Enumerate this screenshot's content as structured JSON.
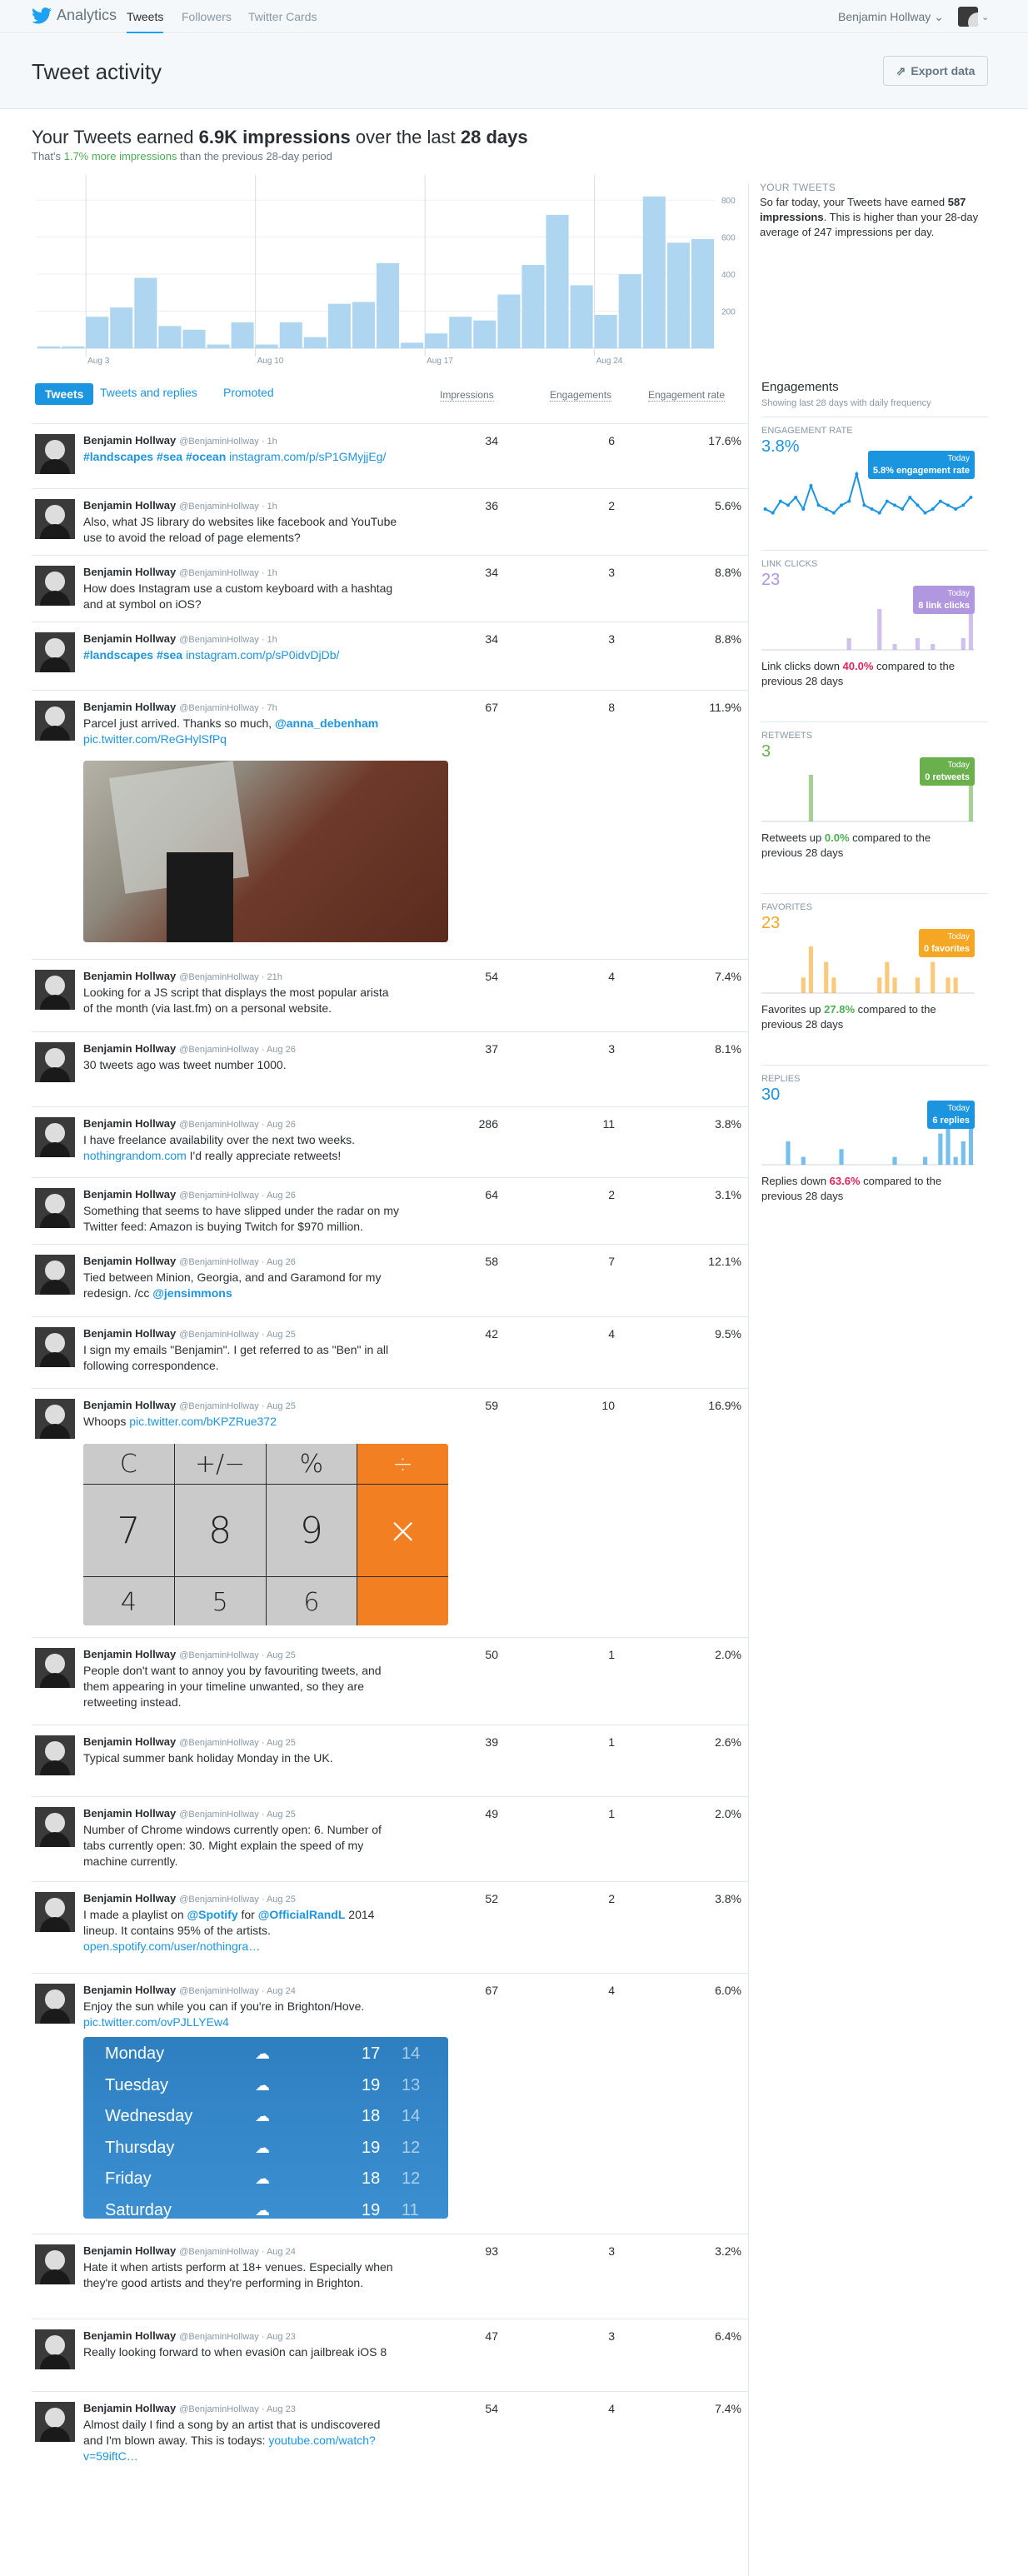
{
  "nav": {
    "brand": "Analytics",
    "tabs": [
      "Tweets",
      "Followers",
      "Twitter Cards"
    ],
    "user": "Benjamin Hollway"
  },
  "header": {
    "title": "Tweet activity",
    "export": "Export data"
  },
  "summary": {
    "prefix": "Your Tweets earned ",
    "impressions": "6.9K impressions",
    "middle": " over the last ",
    "period": "28 days",
    "sub_prefix": "That's ",
    "sub_highlight": "1.7% more impressions",
    "sub_suffix": " than the previous 28-day period"
  },
  "chart_data": {
    "type": "bar",
    "title": "",
    "x_labels": [
      "Aug 3",
      "Aug 10",
      "Aug 17",
      "Aug 24"
    ],
    "ylim": [
      0,
      900
    ],
    "y_ticks": [
      200,
      400,
      600,
      800
    ],
    "values": [
      10,
      10,
      170,
      220,
      380,
      120,
      100,
      20,
      140,
      20,
      140,
      60,
      240,
      250,
      460,
      30,
      80,
      170,
      150,
      290,
      450,
      720,
      340,
      180,
      400,
      820,
      570,
      590
    ],
    "color": "#aed6f1"
  },
  "your_tweets": {
    "label": "YOUR TWEETS",
    "text_prefix": "So far today, your Tweets have earned ",
    "bold": "587 impressions",
    "text_suffix": ". This is higher than your 28-day average of 247 impressions per day."
  },
  "tabs": {
    "items": [
      "Tweets",
      "Tweets and replies",
      "Promoted"
    ],
    "cols": [
      "Impressions",
      "Engagements",
      "Engagement rate"
    ]
  },
  "tweets": [
    {
      "name": "Benjamin Hollway",
      "handle": "@BenjaminHollway · 1h",
      "text": "#landscapes #sea #ocean instagram.com/p/sP1GMyjjEg/",
      "imp": "34",
      "eng": "6",
      "rate": "17.6%"
    },
    {
      "name": "Benjamin Hollway",
      "handle": "@BenjaminHollway · 1h",
      "text": "Also, what JS library do websites like facebook and YouTube use to avoid the reload of page elements?",
      "imp": "36",
      "eng": "2",
      "rate": "5.6%"
    },
    {
      "name": "Benjamin Hollway",
      "handle": "@BenjaminHollway · 1h",
      "text": "How does Instagram use a custom keyboard with a hashtag and at symbol on iOS?",
      "imp": "34",
      "eng": "3",
      "rate": "8.8%"
    },
    {
      "name": "Benjamin Hollway",
      "handle": "@BenjaminHollway · 1h",
      "text": "#landscapes #sea instagram.com/p/sP0idvDjDb/",
      "imp": "34",
      "eng": "3",
      "rate": "8.8%"
    },
    {
      "name": "Benjamin Hollway",
      "handle": "@BenjaminHollway · 7h",
      "text": "Parcel just arrived. Thanks so much, @anna_debenham pic.twitter.com/ReGHylSfPq",
      "imp": "67",
      "eng": "8",
      "rate": "11.9%"
    },
    {
      "name": "Benjamin Hollway",
      "handle": "@BenjaminHollway · 21h",
      "text": "Looking for a JS script that displays the most popular arista of the month (via last.fm) on a personal website.",
      "imp": "54",
      "eng": "4",
      "rate": "7.4%"
    },
    {
      "name": "Benjamin Hollway",
      "handle": "@BenjaminHollway · Aug 26",
      "text": "30 tweets ago was tweet number 1000.",
      "imp": "37",
      "eng": "3",
      "rate": "8.1%"
    },
    {
      "name": "Benjamin Hollway",
      "handle": "@BenjaminHollway · Aug 26",
      "text": "I have freelance availability over the next two weeks. nothingrandom.com I'd really appreciate retweets!",
      "imp": "286",
      "eng": "11",
      "rate": "3.8%"
    },
    {
      "name": "Benjamin Hollway",
      "handle": "@BenjaminHollway · Aug 26",
      "text": "Something that seems to have slipped under the radar on my Twitter feed: Amazon is buying Twitch for $970 million.",
      "imp": "64",
      "eng": "2",
      "rate": "3.1%"
    },
    {
      "name": "Benjamin Hollway",
      "handle": "@BenjaminHollway · Aug 26",
      "text": "Tied between Minion, Georgia, and and Garamond for my redesign. /cc @jensimmons",
      "imp": "58",
      "eng": "7",
      "rate": "12.1%"
    },
    {
      "name": "Benjamin Hollway",
      "handle": "@BenjaminHollway · Aug 25",
      "text": "I sign my emails \"Benjamin\". I get referred to as \"Ben\" in all following correspondence.",
      "imp": "42",
      "eng": "4",
      "rate": "9.5%"
    },
    {
      "name": "Benjamin Hollway",
      "handle": "@BenjaminHollway · Aug 25",
      "text": "Whoops pic.twitter.com/bKPZRue372",
      "imp": "59",
      "eng": "10",
      "rate": "16.9%"
    },
    {
      "name": "Benjamin Hollway",
      "handle": "@BenjaminHollway · Aug 25",
      "text": "People don't want to annoy you by favouriting tweets, and them appearing in your timeline unwanted, so they are retweeting instead.",
      "imp": "50",
      "eng": "1",
      "rate": "2.0%"
    },
    {
      "name": "Benjamin Hollway",
      "handle": "@BenjaminHollway · Aug 25",
      "text": "Typical summer bank holiday Monday in the UK.",
      "imp": "39",
      "eng": "1",
      "rate": "2.6%"
    },
    {
      "name": "Benjamin Hollway",
      "handle": "@BenjaminHollway · Aug 25",
      "text": "Number of Chrome windows currently open: 6. Number of tabs currently open: 30. Might explain the speed of my machine currently.",
      "imp": "49",
      "eng": "1",
      "rate": "2.0%"
    },
    {
      "name": "Benjamin Hollway",
      "handle": "@BenjaminHollway · Aug 25",
      "text": "I made a playlist on @Spotify for @OfficialRandL 2014 lineup. It contains 95% of the artists. open.spotify.com/user/nothingra…",
      "imp": "52",
      "eng": "2",
      "rate": "3.8%"
    },
    {
      "name": "Benjamin Hollway",
      "handle": "@BenjaminHollway · Aug 24",
      "text": "Enjoy the sun while you can if you're in Brighton/Hove. pic.twitter.com/ovPJLLYEw4",
      "imp": "67",
      "eng": "4",
      "rate": "6.0%"
    },
    {
      "name": "Benjamin Hollway",
      "handle": "@BenjaminHollway · Aug 24",
      "text": "Hate it when artists perform at 18+ venues. Especially when they're good artists and they're performing in Brighton.",
      "imp": "93",
      "eng": "3",
      "rate": "3.2%"
    },
    {
      "name": "Benjamin Hollway",
      "handle": "@BenjaminHollway · Aug 23",
      "text": "Really looking forward to when evasi0n can jailbreak iOS 8",
      "imp": "47",
      "eng": "3",
      "rate": "6.4%"
    },
    {
      "name": "Benjamin Hollway",
      "handle": "@BenjaminHollway · Aug 23",
      "text": "Almost daily I find a song by an artist that is undiscovered and I'm blown away. This is todays: youtube.com/watch?v=59iftC…",
      "imp": "54",
      "eng": "4",
      "rate": "7.4%"
    }
  ],
  "calculator": {
    "top": [
      "C",
      "+/−",
      "%",
      "÷"
    ],
    "middle": [
      "7",
      "8",
      "9",
      "×"
    ],
    "bottom": [
      "4",
      "5",
      "6"
    ]
  },
  "weather": [
    {
      "day": "Monday",
      "hi": "17",
      "lo": "14"
    },
    {
      "day": "Tuesday",
      "hi": "19",
      "lo": "13"
    },
    {
      "day": "Wednesday",
      "hi": "18",
      "lo": "14"
    },
    {
      "day": "Thursday",
      "hi": "19",
      "lo": "12"
    },
    {
      "day": "Friday",
      "hi": "18",
      "lo": "12"
    },
    {
      "day": "Saturday",
      "hi": "19",
      "lo": "11"
    }
  ],
  "engagements": {
    "title": "Engagements",
    "subtitle": "Showing last 28 days with daily frequency",
    "rate": {
      "label": "ENGAGEMENT RATE",
      "value": "3.8%",
      "today": "Today",
      "callout": "5.8% engagement rate",
      "color": "#1b95e0",
      "values": [
        3,
        2,
        5,
        4,
        6,
        3,
        9,
        4,
        3,
        2,
        4,
        5,
        12,
        4,
        3,
        2,
        5,
        4,
        3,
        6,
        4,
        2,
        3,
        5,
        4,
        3,
        4,
        6
      ]
    },
    "link": {
      "label": "LINK CLICKS",
      "value": "23",
      "today": "Today",
      "callout": "8 link clicks",
      "color": "#b197e0",
      "values": [
        0,
        0,
        0,
        0,
        0,
        0,
        0,
        0,
        0,
        0,
        0,
        2,
        0,
        0,
        0,
        7,
        0,
        1,
        0,
        0,
        2,
        0,
        1,
        0,
        0,
        0,
        2,
        8
      ],
      "note_prefix": "Link clicks down ",
      "note_value": "40.0%",
      "note_suffix": " compared to the previous 28 days"
    },
    "retweets": {
      "label": "RETWEETS",
      "value": "3",
      "today": "Today",
      "callout": "0 retweets",
      "color": "#6ab04c",
      "values": [
        0,
        0,
        0,
        0,
        0,
        0,
        1,
        0,
        0,
        0,
        0,
        0,
        0,
        0,
        0,
        0,
        0,
        0,
        0,
        0,
        0,
        0,
        0,
        0,
        0,
        0,
        0,
        1
      ],
      "note_prefix": "Retweets up ",
      "note_value": "0.0%",
      "note_suffix": " compared to the previous 28 days"
    },
    "favorites": {
      "label": "FAVORITES",
      "value": "23",
      "today": "Today",
      "callout": "0 favorites",
      "color": "#f5a623",
      "values": [
        0,
        0,
        0,
        0,
        0,
        1,
        3,
        0,
        2,
        1,
        0,
        0,
        0,
        0,
        0,
        1,
        2,
        1,
        0,
        0,
        1,
        0,
        2,
        0,
        1,
        1,
        0,
        0
      ],
      "note_prefix": "Favorites up ",
      "note_value": "27.8%",
      "note_suffix": " compared to the previous 28 days"
    },
    "replies": {
      "label": "REPLIES",
      "value": "30",
      "today": "Today",
      "callout": "6 replies",
      "color": "#1b95e0",
      "values": [
        0,
        0,
        0,
        3,
        0,
        1,
        0,
        0,
        0,
        0,
        2,
        0,
        0,
        0,
        0,
        0,
        0,
        1,
        0,
        0,
        0,
        1,
        0,
        4,
        5,
        1,
        3,
        6
      ],
      "note_prefix": "Replies down ",
      "note_value": "63.6%",
      "note_suffix": " compared to the previous 28 days"
    }
  }
}
